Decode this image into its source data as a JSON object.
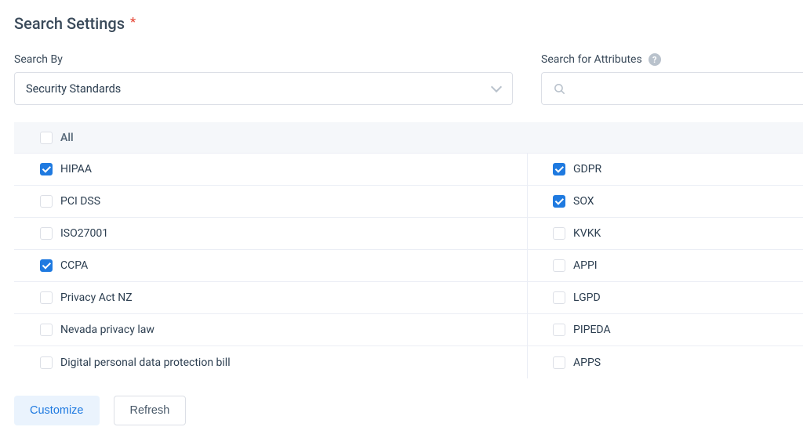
{
  "header": {
    "title": "Search Settings",
    "required_marker": "*"
  },
  "search_by": {
    "label": "Search By",
    "selected": "Security Standards"
  },
  "search_attributes": {
    "label": "Search for Attributes",
    "placeholder": ""
  },
  "grid": {
    "all_label": "All",
    "all_checked": false,
    "left": [
      {
        "label": "HIPAA",
        "checked": true
      },
      {
        "label": "PCI DSS",
        "checked": false
      },
      {
        "label": "ISO27001",
        "checked": false
      },
      {
        "label": "CCPA",
        "checked": true
      },
      {
        "label": "Privacy Act NZ",
        "checked": false
      },
      {
        "label": "Nevada privacy law",
        "checked": false
      },
      {
        "label": "Digital personal data protection bill",
        "checked": false
      }
    ],
    "right": [
      {
        "label": "GDPR",
        "checked": true
      },
      {
        "label": "SOX",
        "checked": true
      },
      {
        "label": "KVKK",
        "checked": false
      },
      {
        "label": "APPI",
        "checked": false
      },
      {
        "label": "LGPD",
        "checked": false
      },
      {
        "label": "PIPEDA",
        "checked": false
      },
      {
        "label": "APPS",
        "checked": false
      }
    ]
  },
  "actions": {
    "customize": "Customize",
    "refresh": "Refresh"
  }
}
